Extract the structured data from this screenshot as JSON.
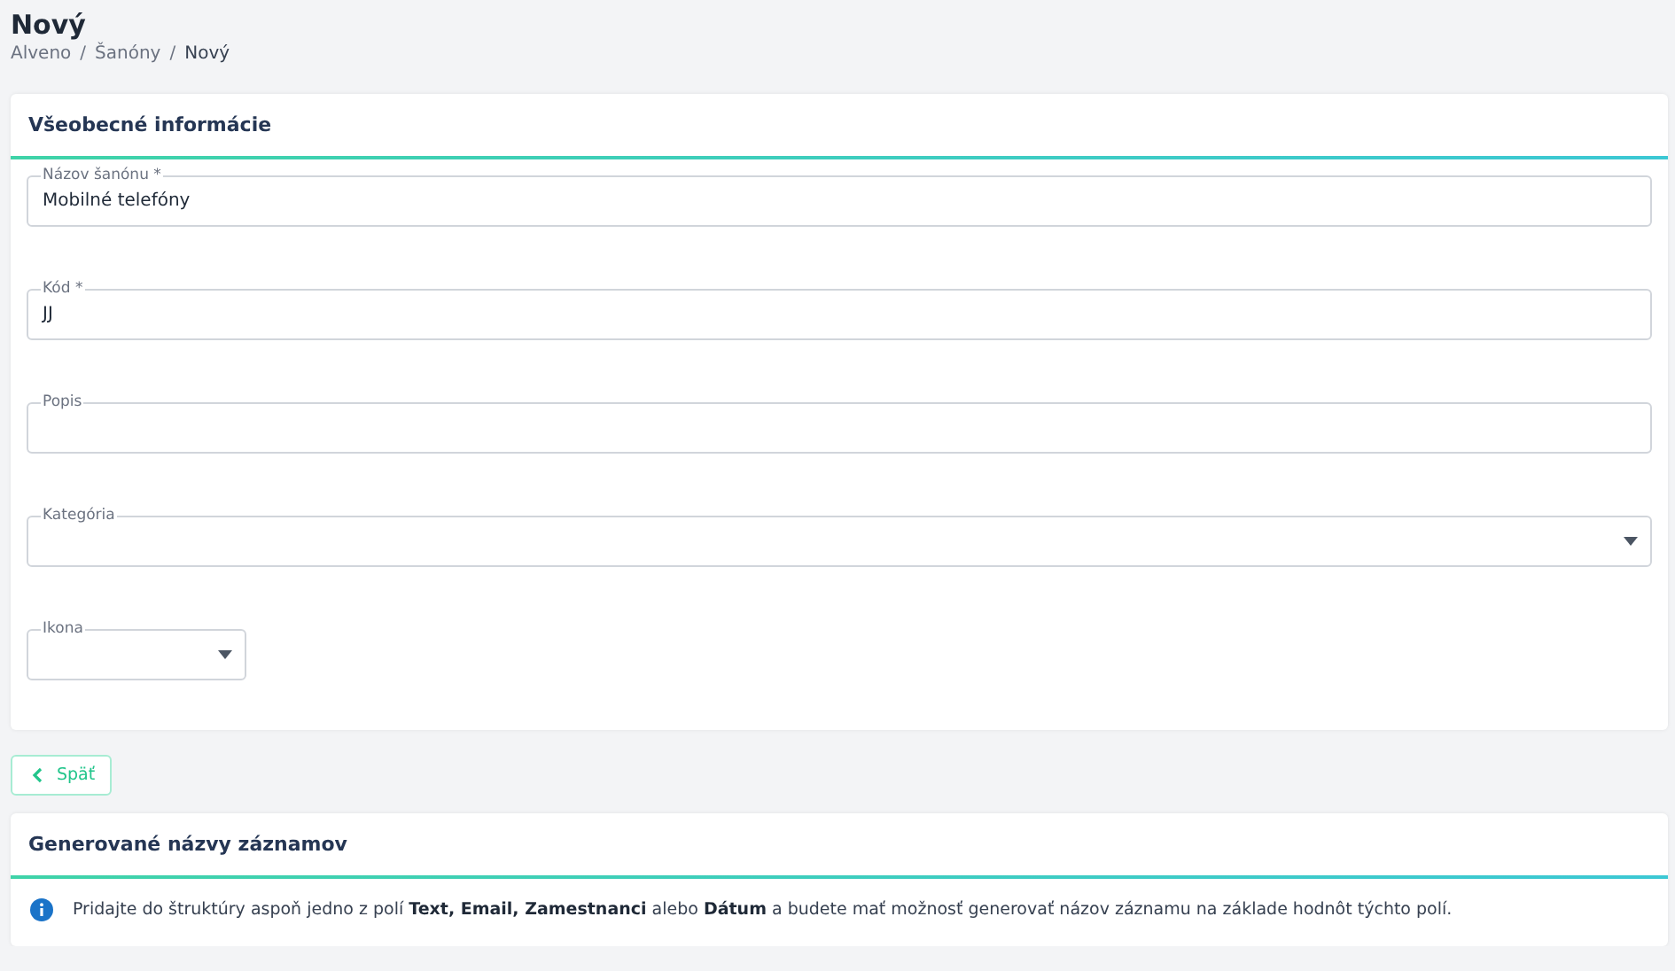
{
  "page": {
    "title": "Nový",
    "breadcrumb": [
      {
        "label": "Alveno",
        "current": false
      },
      {
        "label": "Šanóny",
        "current": false
      },
      {
        "label": "Nový",
        "current": true
      }
    ],
    "breadcrumb_separators": [
      "/",
      "/"
    ]
  },
  "general": {
    "title": "Všeobecné informácie",
    "fields": [
      {
        "kind": "text",
        "label": "Názov šanónu *",
        "value": "Mobilné telefóny"
      },
      {
        "kind": "text",
        "label": "Kód *",
        "value": "JJ"
      },
      {
        "kind": "text",
        "label": "Popis"
      },
      {
        "kind": "select",
        "label": "Kategória"
      },
      {
        "kind": "small-select",
        "label": "Ikona"
      }
    ]
  },
  "back_button": {
    "label": "Späť"
  },
  "generated_names": {
    "title": "Generované názvy záznamov",
    "info": "Pridajte do štruktúry aspoň jedno z polí **Text, Email, Zamestnanci** alebo **Dátum** a budete mať možnosť generovať názov záznamu na základe hodnôt týchto polí."
  }
}
